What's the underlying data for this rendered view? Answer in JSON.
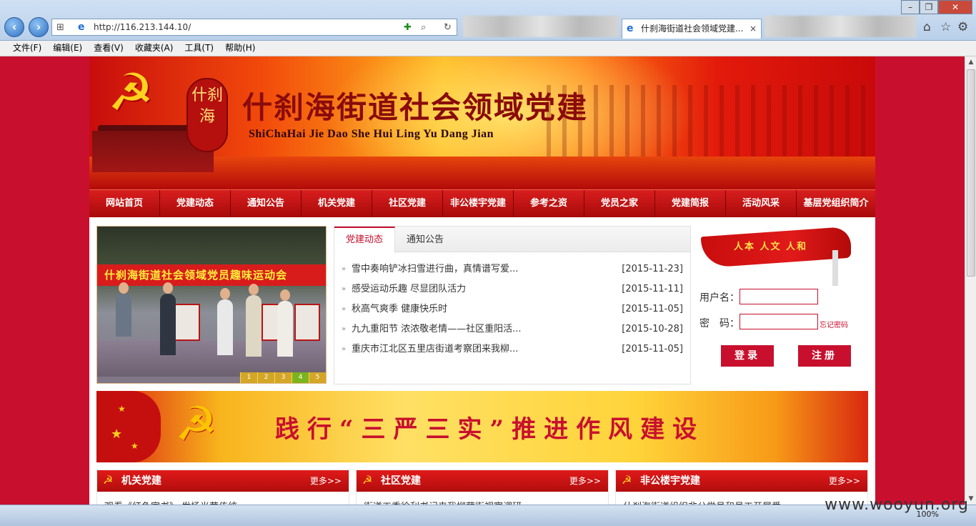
{
  "browser": {
    "url": "http://116.213.144.10/",
    "tab_title": "什刹海街道社会领域党建...",
    "menu": [
      "文件(F)",
      "编辑(E)",
      "查看(V)",
      "收藏夹(A)",
      "工具(T)",
      "帮助(H)"
    ],
    "zoom": "100%"
  },
  "banner": {
    "title": "什刹海街道社会领域党建",
    "subtitle": "ShiChaHai Jie Dao She Hui Ling Yu Dang Jian",
    "seal_text": "什刹海"
  },
  "nav": [
    "网站首页",
    "党建动态",
    "通知公告",
    "机关党建",
    "社区党建",
    "非公楼宇党建",
    "参考之资",
    "党员之家",
    "党建简报",
    "活动风采",
    "基层党组织简介"
  ],
  "slideshow": {
    "caption": "什刹海街道社会领域党员趣味运动会",
    "pages": [
      "1",
      "2",
      "3",
      "4",
      "5"
    ],
    "active": 4
  },
  "news": {
    "tabs": [
      "党建动态",
      "通知公告"
    ],
    "items": [
      {
        "title": "雪中奏响铲冰扫雪进行曲，真情谱写爱...",
        "date": "[2015-11-23]"
      },
      {
        "title": "感受运动乐趣 尽显团队活力",
        "date": "[2015-11-11]"
      },
      {
        "title": "秋高气爽季 健康快乐时",
        "date": "[2015-11-05]"
      },
      {
        "title": "九九重阳节 浓浓敬老情——社区重阳活...",
        "date": "[2015-10-28]"
      },
      {
        "title": "重庆市江北区五里店街道考察团来我柳...",
        "date": "[2015-11-05]"
      }
    ]
  },
  "login": {
    "motto": "人本 人文 人和",
    "username_label": "用户名：",
    "password_label": "密　码：",
    "forgot": "忘记密码",
    "login_btn": "登录",
    "register_btn": "注册"
  },
  "slogan": "践行“三严三实”推进作风建设",
  "sections": [
    {
      "title": "机关党建",
      "more": "更多>>",
      "first": "观看《红色家书》 发扬光荣传统"
    },
    {
      "title": "社区党建",
      "more": "更多>>",
      "first": "街道工委徐利书记来我柳荫街视察调研"
    },
    {
      "title": "非公楼宇党建",
      "more": "更多>>",
      "first": "什刹海街道组织非公党员和员工开展爱"
    }
  ],
  "watermark": "www.wooyun.org"
}
